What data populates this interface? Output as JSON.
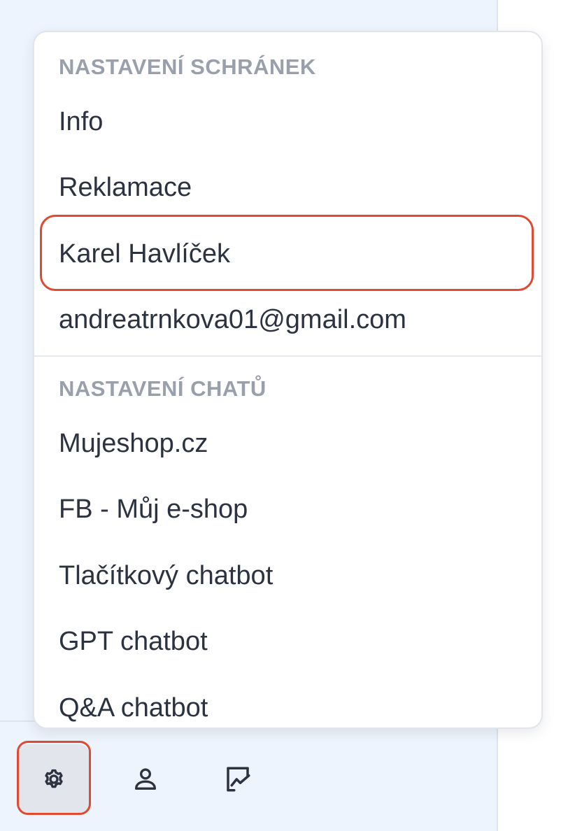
{
  "menu": {
    "mailbox_header": "NASTAVENÍ SCHRÁNEK",
    "mailbox_items": [
      {
        "label": "Info"
      },
      {
        "label": "Reklamace"
      },
      {
        "label": "Karel Havlíček"
      },
      {
        "label": "andreatrnkova01@gmail.com"
      }
    ],
    "chat_header": "NASTAVENÍ CHATŮ",
    "chat_items": [
      {
        "label": "Mujeshop.cz"
      },
      {
        "label": "FB - Můj e-shop"
      },
      {
        "label": "Tlačítkový chatbot"
      },
      {
        "label": "GPT chatbot"
      },
      {
        "label": "Q&A chatbot"
      }
    ]
  },
  "bottom_bar": {
    "buttons": [
      {
        "icon": "gear-icon",
        "active": true
      },
      {
        "icon": "user-icon",
        "active": false
      },
      {
        "icon": "chart-icon",
        "active": false
      }
    ]
  },
  "highlight_color": "#e04a33",
  "panel_background": "#eef4fd"
}
